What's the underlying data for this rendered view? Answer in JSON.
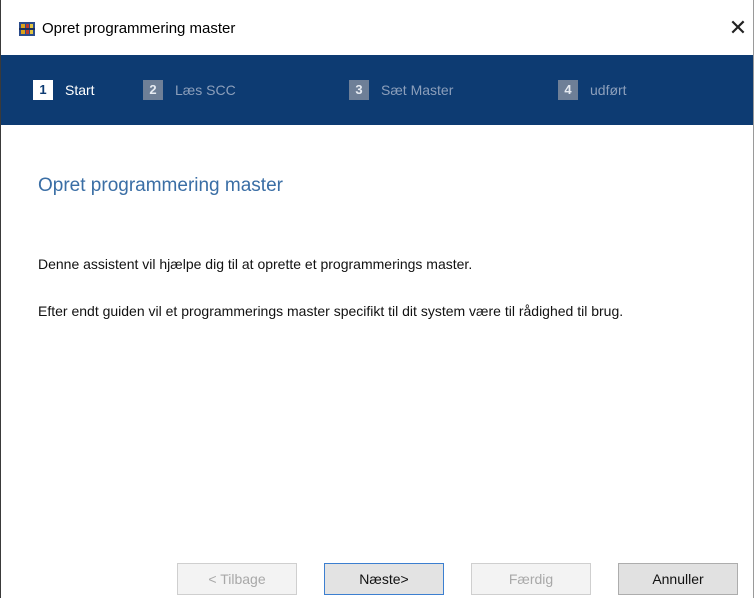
{
  "window": {
    "title": "Opret programmering master",
    "close_symbol": "✕"
  },
  "steps": [
    {
      "number": "1",
      "label": "Start",
      "active": true
    },
    {
      "number": "2",
      "label": "Læs SCC",
      "active": false
    },
    {
      "number": "3",
      "label": "Sæt Master",
      "active": false
    },
    {
      "number": "4",
      "label": "udført",
      "active": false
    }
  ],
  "content": {
    "heading": "Opret programmering master",
    "paragraph1": "Denne assistent vil hjælpe dig til at oprette et programmerings master.",
    "paragraph2": "Efter endt guiden vil et programmerings master specifikt til dit system være til rådighed til brug."
  },
  "buttons": {
    "back": "< Tilbage",
    "next": "Næste>",
    "finish": "Færdig",
    "cancel": "Annuller"
  },
  "colors": {
    "step_bar": "#0d3b72",
    "heading": "#3a6ea5",
    "focus_border": "#3c7fd0"
  },
  "icons": {
    "app": "app-icon",
    "close": "close-icon"
  }
}
